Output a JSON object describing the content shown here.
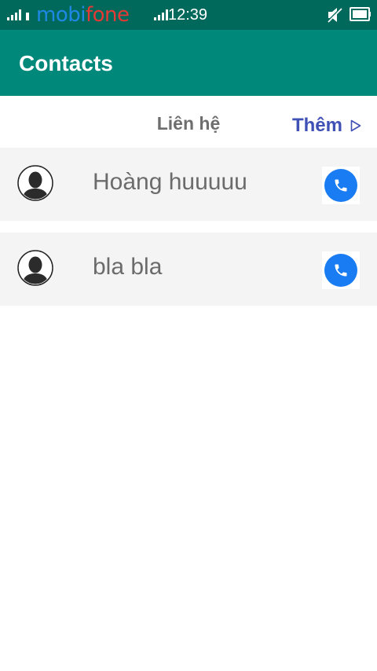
{
  "status_bar": {
    "carrier_part1": "mobi",
    "carrier_part2": "fone",
    "time": "12:39",
    "icons": [
      "signal-icon",
      "signal-icon",
      "mute-icon",
      "battery-icon"
    ]
  },
  "app_bar": {
    "title": "Contacts"
  },
  "header": {
    "title": "Liên hệ",
    "more_label": "Thêm",
    "more_icon": "play-arrow-icon"
  },
  "contacts": [
    {
      "name": "Hoàng huuuuu",
      "avatar_icon": "person-avatar-icon",
      "call_icon": "phone-icon"
    },
    {
      "name": "bla bla",
      "avatar_icon": "person-avatar-icon",
      "call_icon": "phone-icon"
    }
  ],
  "colors": {
    "status_bar": "#00695c",
    "app_bar": "#00897b",
    "accent_link": "#3f51b5",
    "call_button": "#1a7cf2",
    "row_background": "#f4f4f4"
  }
}
